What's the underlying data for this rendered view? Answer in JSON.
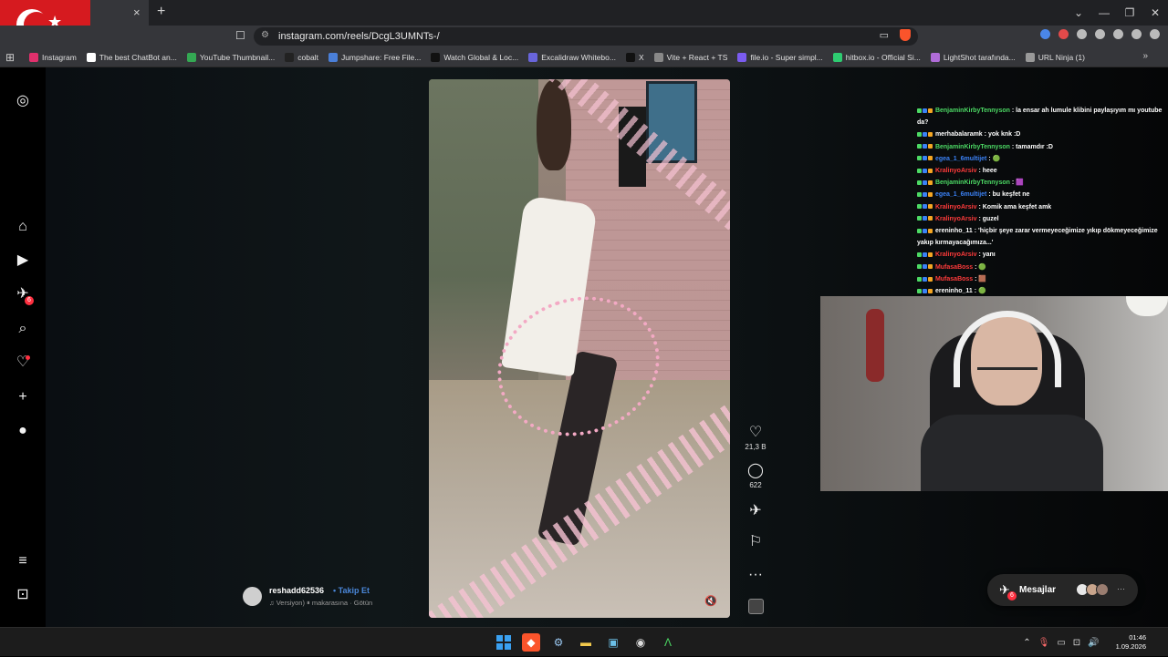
{
  "browser": {
    "tab_close": "×",
    "tab_new": "+",
    "window_controls": [
      "⌄",
      "—",
      "❐",
      "✕"
    ],
    "url": "instagram.com/reels/DcgL3UMNTs-/",
    "bookmarks": [
      {
        "label": "Instagram",
        "color": "#e1306c"
      },
      {
        "label": "The best ChatBot an...",
        "color": "#ffffff"
      },
      {
        "label": "YouTube Thumbnail...",
        "color": "#34a853"
      },
      {
        "label": "cobalt",
        "color": "#222222"
      },
      {
        "label": "Jumpshare: Free File...",
        "color": "#4a7fd8"
      },
      {
        "label": "Watch Global & Loc...",
        "color": "#111111"
      },
      {
        "label": "Excalidraw Whitebo...",
        "color": "#6965db"
      },
      {
        "label": "X",
        "color": "#111111"
      },
      {
        "label": "Vite + React + TS",
        "color": "#888888"
      },
      {
        "label": "file.io - Super simpl...",
        "color": "#7b5cf0"
      },
      {
        "label": "hitbox.io - Official Si...",
        "color": "#2ecc71"
      },
      {
        "label": "LightShot tarafında...",
        "color": "#b06cd8"
      },
      {
        "label": "URL Ninja (1)",
        "color": "#999999"
      }
    ],
    "bookmarks_more": "»"
  },
  "sidebar": {
    "notifications_count": "6"
  },
  "reel": {
    "likes": "21,3 B",
    "comments": "622",
    "more": "···",
    "author": "reshadd62536",
    "separator": "•",
    "follow_label": "Takip Et",
    "audio": "♫  Versiyon)  ⏸  makarasına · Götün"
  },
  "chat": {
    "messages": [
      {
        "user": "BenjaminKirbyTennyson",
        "color": "#4cd964",
        "text": ": la ensar ah lumule klibini paylaşıyım mı youtube da?",
        "wrap": true
      },
      {
        "user": "merhabalaramk",
        "color": "#ffffff",
        "text": ": yok knk :D"
      },
      {
        "user": "BenjaminKirbyTennyson",
        "color": "#4cd964",
        "text": ": tamamdır :D"
      },
      {
        "user": "egea_1_6multijet",
        "color": "#3b82f6",
        "text": ": 🟢"
      },
      {
        "user": "KralinyoArsiv",
        "color": "#ff3b3b",
        "text": ": heee"
      },
      {
        "user": "BenjaminKirbyTennyson",
        "color": "#4cd964",
        "text": ": 🟪"
      },
      {
        "user": "egea_1_6multijet",
        "color": "#3b82f6",
        "text": ": bu keşfet ne"
      },
      {
        "user": "KralinyoArsiv",
        "color": "#ff3b3b",
        "text": ": Komik ama keşfet amk"
      },
      {
        "user": "KralinyoArsiv",
        "color": "#ff3b3b",
        "text": ": guzel"
      },
      {
        "user": "ereninho_11",
        "color": "#ffffff",
        "text": ": 'hiçbir şeye zarar vermeyeceğimize yıkıp dökmeyeceğimize yakıp kırmayacağımıza...'",
        "wrap": true
      },
      {
        "user": "KralinyoArsiv",
        "color": "#ff3b3b",
        "text": ": yanı"
      },
      {
        "user": "MufasaBoss",
        "color": "#ff3b3b",
        "text": ": 🟢"
      },
      {
        "user": "MufasaBoss",
        "color": "#ff3b3b",
        "text": ": 🟫"
      },
      {
        "user": "ereninho_11",
        "color": "#ffffff",
        "text": ": 🟢"
      }
    ]
  },
  "messages_pill": {
    "label": "Mesajlar",
    "badge": "6",
    "more": "···"
  },
  "taskbar": {
    "time": "01:46",
    "date": "1.09.2026"
  }
}
